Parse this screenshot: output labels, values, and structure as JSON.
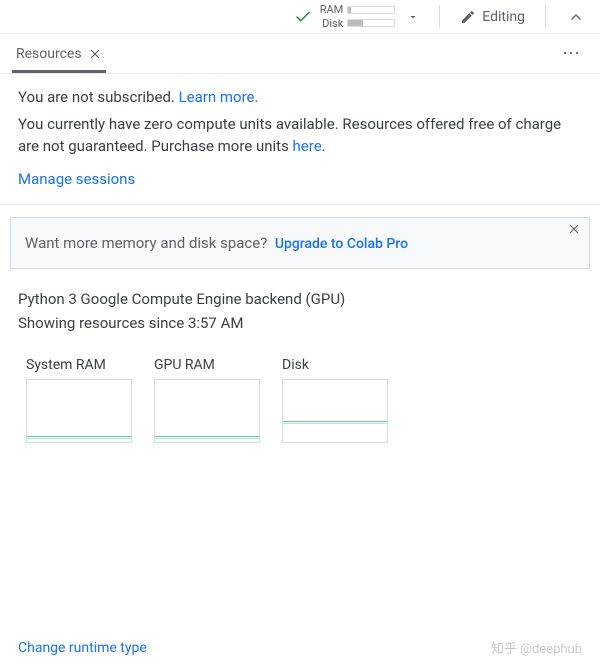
{
  "topbar": {
    "ram_label": "RAM",
    "disk_label": "Disk",
    "editing_label": "Editing"
  },
  "tab": {
    "title": "Resources"
  },
  "messages": {
    "not_subscribed": "You are not subscribed. ",
    "learn_more": "Learn more.",
    "zero_units": "You currently have zero compute units available. Resources offered free of charge are not guaranteed. Purchase more units ",
    "here": "here",
    "period": ".",
    "manage_sessions": "Manage sessions"
  },
  "upgrade": {
    "prompt": "Want more memory and disk space?",
    "cta": "Upgrade to Colab Pro"
  },
  "backend": {
    "line1": "Python 3 Google Compute Engine backend (GPU)",
    "line2": "Showing resources since 3:57 AM"
  },
  "charts": {
    "ram_title": "System RAM",
    "gpu_title": "GPU RAM",
    "disk_title": "Disk"
  },
  "footer": {
    "change_runtime": "Change runtime type",
    "watermark": "知乎 @deephub"
  },
  "chart_data": [
    {
      "type": "line",
      "title": "System RAM",
      "x": [],
      "values": [],
      "ylim": [
        0,
        100
      ],
      "note": "near-zero flat line"
    },
    {
      "type": "line",
      "title": "GPU RAM",
      "x": [],
      "values": [],
      "ylim": [
        0,
        100
      ],
      "note": "near-zero flat line"
    },
    {
      "type": "line",
      "title": "Disk",
      "x": [],
      "values": [],
      "ylim": [
        0,
        100
      ],
      "note": "low flat line (~30%)"
    }
  ]
}
